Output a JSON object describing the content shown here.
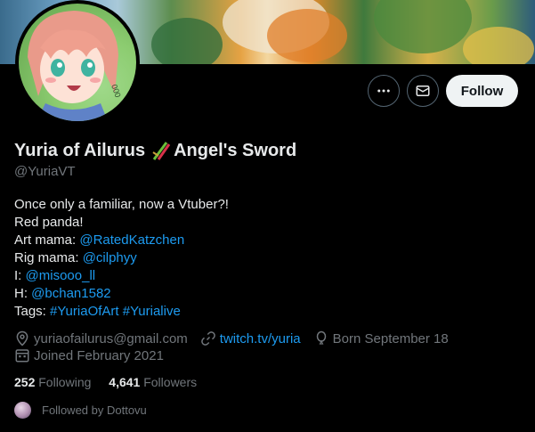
{
  "profile": {
    "display_name": "Yuria of Ailurus",
    "name_suffix": "Angel's Sword",
    "handle": "@YuriaVT",
    "avatar_badge": "000",
    "accent_color": "#1d9bf0"
  },
  "actions": {
    "more_icon": "more-icon",
    "message_icon": "envelope-icon",
    "follow_label": "Follow"
  },
  "bio": {
    "line1": "Once only a familiar, now a Vtuber?!",
    "line2": "Red panda!",
    "art_label": "Art mama: ",
    "art_link": "@RatedKatzchen",
    "rig_label": "Rig mama: ",
    "rig_link": "@cilphyy",
    "i_label": "I: ",
    "i_link": "@misooo_ll",
    "h_label": "H: ",
    "h_link": "@bchan1582",
    "tags_label": "Tags: ",
    "tag1": "#YuriaOfArt",
    "tag2": "#Yurialive"
  },
  "meta": {
    "location": "yuriaofailurus@gmail.com",
    "website": "twitch.tv/yuria",
    "birthday": "Born September 18",
    "joined": "Joined February 2021"
  },
  "counts": {
    "following_num": "252",
    "following_label": "Following",
    "followers_num": "4,641",
    "followers_label": "Followers"
  },
  "followed_by": "Followed by Dottovu"
}
